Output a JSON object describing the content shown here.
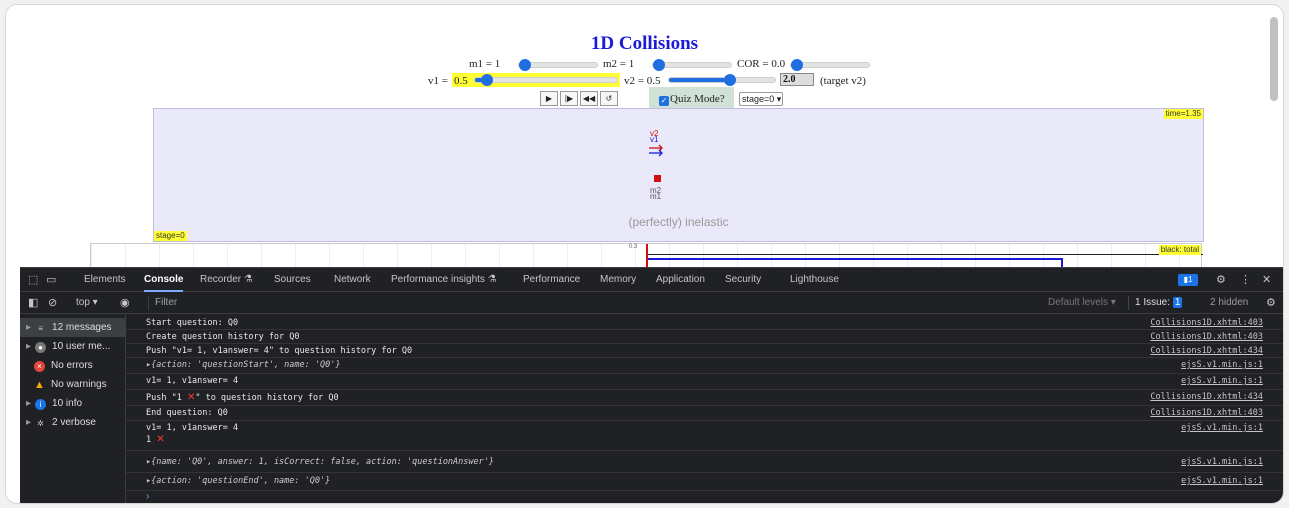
{
  "sim": {
    "title": "1D Collisions",
    "m1_label": "m1 = 1",
    "m2_label": "m2 = 1",
    "cor_label": "COR = 0.0",
    "v1_label": "v1 = ",
    "v1_value": "0.5",
    "v2_label": "v2 = 0.5",
    "target_value": "2.0",
    "target_label": "(target v2)",
    "sliders": {
      "m1": 0.1,
      "m2": 0.1,
      "cor": 0.0,
      "v1": 0.2,
      "v2": 0.55
    },
    "controls": [
      "▶",
      "|▶",
      "◀◀",
      "↺"
    ],
    "quiz_label": "Quiz Mode?",
    "stage_select": "stage=0 ▾",
    "time_label": "time=1.35",
    "stage_label": "stage=0",
    "v2_vec": "v2",
    "v1_vec": "v1",
    "m2_tag": "m2",
    "m1_tag": "m1",
    "inelastic_text": "(perfectly) inelastic",
    "graph_tick": "0.3",
    "graph_label": "black: total",
    "colors": {
      "title": "#1a1ad8",
      "accent": "#1f6fe0",
      "highlight": "#ffff33",
      "mass": "#d01010"
    }
  },
  "devtools": {
    "tabs": [
      "Elements",
      "Console",
      "Recorder ⚗",
      "Sources",
      "Network",
      "Performance insights ⚗",
      "Performance",
      "Memory",
      "Application",
      "Security",
      "Lighthouse"
    ],
    "active_tab": "Console",
    "message_badge": "1",
    "context": "top ▾",
    "filter_placeholder": "Filter",
    "default_levels": "Default levels ▾",
    "issue_label": "1 Issue:",
    "issue_count": "1",
    "hidden": "2 hidden",
    "sidebar": [
      {
        "icon": "list-icon",
        "label": "12 messages"
      },
      {
        "icon": "user-icon",
        "label": "10 user me..."
      },
      {
        "icon": "error-icon",
        "label": "No errors"
      },
      {
        "icon": "warning-icon",
        "label": "No warnings"
      },
      {
        "icon": "info-icon",
        "label": "10 info"
      },
      {
        "icon": "verbose-icon",
        "label": "2 verbose"
      }
    ],
    "log": [
      {
        "msg": "Start question: Q0",
        "src": "Collisions1D.xhtml:403"
      },
      {
        "msg": "Create question history for Q0",
        "src": "Collisions1D.xhtml:403"
      },
      {
        "msg": "Push \"v1= 1, v1answer= 4\" to question history for Q0",
        "src": "Collisions1D.xhtml:434"
      },
      {
        "msg": "{action: 'questionStart', name: 'Q0'}",
        "src": "ejsS.v1.min.js:1"
      },
      {
        "msg": "v1= 1, v1answer= 4",
        "src": "ejsS.v1.min.js:1"
      },
      {
        "msg_pre": "Push \"1 ",
        "msg_post": "\" to question history for Q0",
        "src": "Collisions1D.xhtml:434"
      },
      {
        "msg": "End question: Q0",
        "src": "Collisions1D.xhtml:403"
      },
      {
        "msg": "v1= 1, v1answer= 4",
        "msg2": "1 ",
        "src": "ejsS.v1.min.js:1"
      },
      {
        "msg": "{name: 'Q0', answer: 1, isCorrect: false, action: 'questionAnswer'}",
        "src": "ejsS.v1.min.js:1"
      },
      {
        "msg": "{action: 'questionEnd', name: 'Q0'}",
        "src": "ejsS.v1.min.js:1"
      }
    ],
    "prompt": "›"
  }
}
